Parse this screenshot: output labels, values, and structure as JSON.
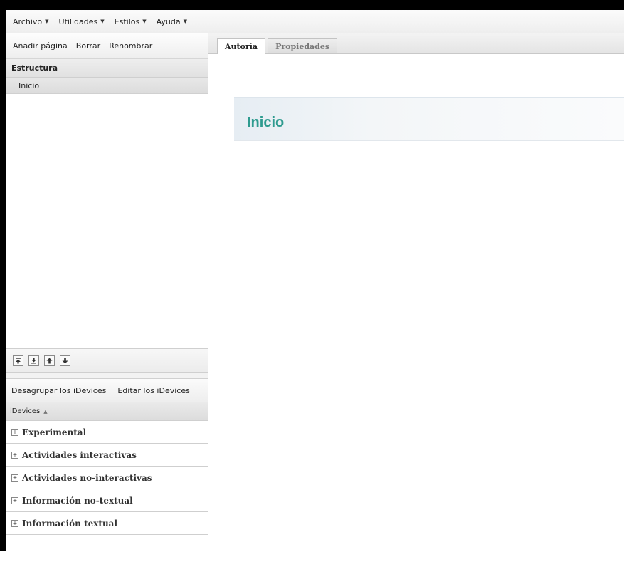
{
  "menubar": {
    "items": [
      {
        "label": "Archivo"
      },
      {
        "label": "Utilidades"
      },
      {
        "label": "Estilos"
      },
      {
        "label": "Ayuda"
      }
    ]
  },
  "structure_toolbar": {
    "add_page": "Añadir página",
    "delete": "Borrar",
    "rename": "Renombrar"
  },
  "structure": {
    "header": "Estructura",
    "nodes": [
      {
        "label": "Inicio",
        "selected": true
      }
    ]
  },
  "node_nav": {
    "icons": [
      "move-top-icon",
      "move-bottom-icon",
      "move-up-icon",
      "move-down-icon"
    ]
  },
  "idevices_toolbar": {
    "ungroup": "Desagrupar los iDevices",
    "edit": "Editar los iDevices"
  },
  "idevices": {
    "header": "iDevices",
    "categories": [
      "Experimental",
      "Actividades interactivas",
      "Actividades no-interactivas",
      "Información no-textual",
      "Información textual"
    ]
  },
  "tabs": [
    {
      "label": "Autoría",
      "active": true
    },
    {
      "label": "Propiedades",
      "active": false
    }
  ],
  "page": {
    "title": "Inicio",
    "title_color": "#2e9b8f"
  }
}
